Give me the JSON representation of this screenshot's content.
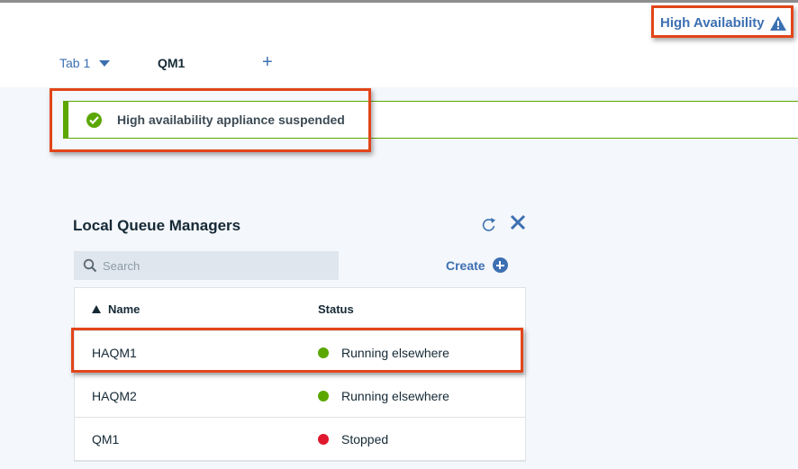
{
  "header": {
    "ha_link_label": "High Availability",
    "ha_icon": "warning-triangle-icon"
  },
  "tabs": [
    {
      "label": "Tab 1",
      "active": true
    },
    {
      "label": "QM1",
      "active": false
    },
    {
      "label": "+",
      "icon": "add-tab-icon"
    }
  ],
  "notification": {
    "text": "High availability appliance suspended",
    "icon": "checkmark-circle-icon",
    "color": "#5aa700"
  },
  "panel": {
    "title": "Local Queue Managers",
    "search_placeholder": "Search",
    "create_label": "Create",
    "columns": {
      "name": "Name",
      "status": "Status"
    },
    "rows": [
      {
        "name": "HAQM1",
        "status": "Running elsewhere",
        "status_color": "#5aa700"
      },
      {
        "name": "HAQM2",
        "status": "Running elsewhere",
        "status_color": "#5aa700"
      },
      {
        "name": "QM1",
        "status": "Stopped",
        "status_color": "#e0182d"
      }
    ]
  },
  "colors": {
    "accent": "#3d70b2",
    "highlight": "#e2451a",
    "success": "#5aa700",
    "error": "#e0182d"
  }
}
